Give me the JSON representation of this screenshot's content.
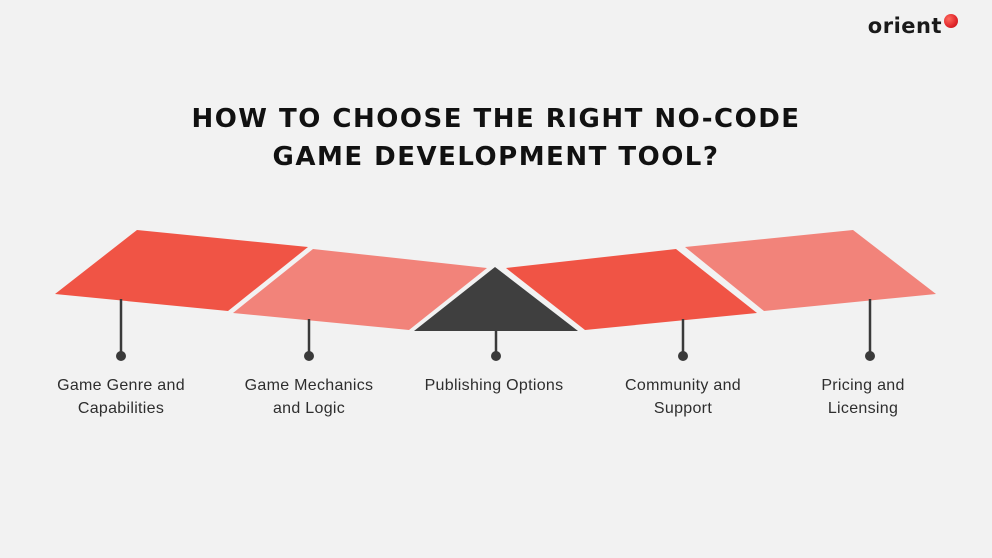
{
  "brand": {
    "name": "orient",
    "accent": "#e0262b"
  },
  "title": {
    "line1": "HOW TO CHOOSE THE RIGHT NO-CODE",
    "line2": "GAME DEVELOPMENT TOOL?"
  },
  "colors": {
    "primary_red": "#f05445",
    "light_red": "#f2837a",
    "dark": "#3f3f3f",
    "connector": "#3a3a3a"
  },
  "steps": [
    {
      "label_line1": "Game Genre and",
      "label_line2": "Capabilities"
    },
    {
      "label_line1": "Game Mechanics",
      "label_line2": "and Logic"
    },
    {
      "label_line1": "Publishing Options",
      "label_line2": ""
    },
    {
      "label_line1": "Community and",
      "label_line2": "Support"
    },
    {
      "label_line1": "Pricing and",
      "label_line2": "Licensing"
    }
  ]
}
